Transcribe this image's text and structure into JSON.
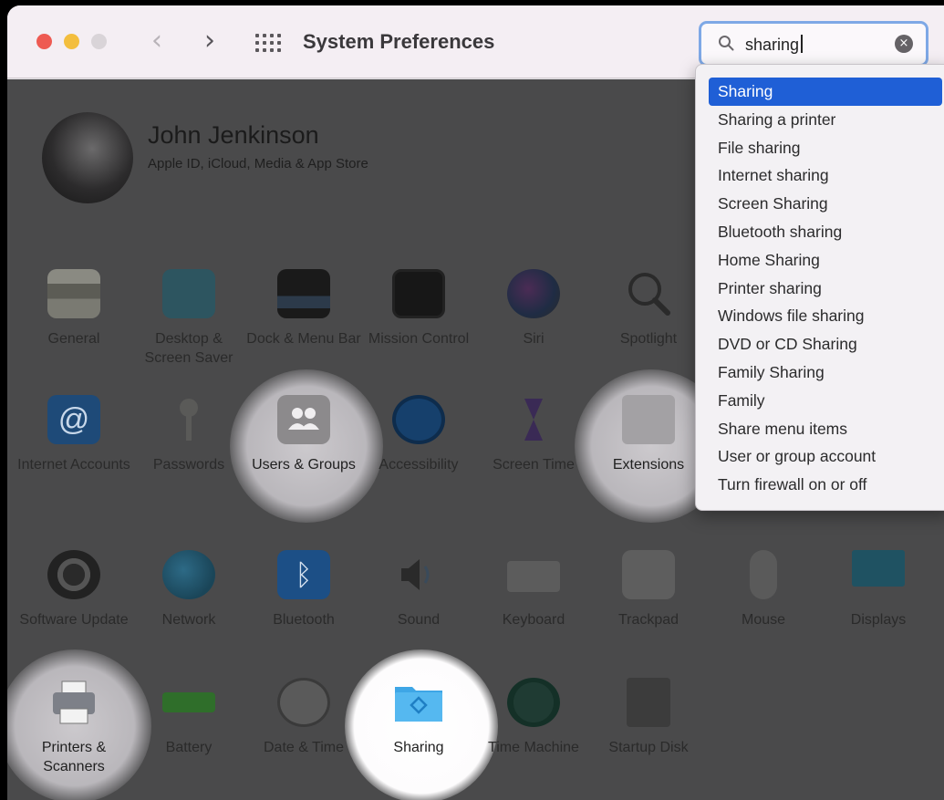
{
  "window": {
    "title": "System Preferences",
    "back_glyph": "‹",
    "forward_glyph": "›"
  },
  "search": {
    "value": "sharing",
    "clear_glyph": "×"
  },
  "account": {
    "name": "John Jenkinson",
    "subtitle": "Apple ID, iCloud, Media & App Store"
  },
  "panes": {
    "row1": [
      {
        "label": "General",
        "icon": "general-icon"
      },
      {
        "label": "Desktop & Screen Saver",
        "icon": "desktop-icon"
      },
      {
        "label": "Dock & Menu Bar",
        "icon": "dock-icon"
      },
      {
        "label": "Mission Control",
        "icon": "mission-control-icon"
      },
      {
        "label": "Siri",
        "icon": "siri-icon"
      },
      {
        "label": "Spotlight",
        "icon": "spotlight-icon"
      }
    ],
    "row2": [
      {
        "label": "Internet Accounts",
        "icon": "at-icon"
      },
      {
        "label": "Passwords",
        "icon": "key-icon"
      },
      {
        "label": "Users & Groups",
        "icon": "users-icon"
      },
      {
        "label": "Accessibility",
        "icon": "accessibility-icon"
      },
      {
        "label": "Screen Time",
        "icon": "hourglass-icon"
      },
      {
        "label": "Extensions",
        "icon": "puzzle-icon"
      }
    ],
    "row3": [
      {
        "label": "Software Update",
        "icon": "gear-icon"
      },
      {
        "label": "Network",
        "icon": "globe-icon"
      },
      {
        "label": "Bluetooth",
        "icon": "bluetooth-icon"
      },
      {
        "label": "Sound",
        "icon": "speaker-icon"
      },
      {
        "label": "Keyboard",
        "icon": "keyboard-icon"
      },
      {
        "label": "Trackpad",
        "icon": "trackpad-icon"
      },
      {
        "label": "Mouse",
        "icon": "mouse-icon"
      },
      {
        "label": "Displays",
        "icon": "display-icon"
      }
    ],
    "row4": [
      {
        "label": "Printers & Scanners",
        "icon": "printer-icon"
      },
      {
        "label": "Battery",
        "icon": "battery-icon"
      },
      {
        "label": "Date & Time",
        "icon": "clock-icon"
      },
      {
        "label": "Sharing",
        "icon": "folder-icon"
      },
      {
        "label": "Time Machine",
        "icon": "time-machine-icon"
      },
      {
        "label": "Startup Disk",
        "icon": "disk-icon"
      }
    ]
  },
  "suggestions": [
    "Sharing",
    "Sharing a printer",
    "File sharing",
    "Internet sharing",
    "Screen Sharing",
    "Bluetooth sharing",
    "Home Sharing",
    "Printer sharing",
    "Windows file sharing",
    "DVD or CD Sharing",
    "Family Sharing",
    "Family",
    "Share menu items",
    "User or group account",
    "Turn firewall on or off"
  ],
  "colors": {
    "selection": "#1f5fd6",
    "search_focus": "#7ea8e6",
    "dim_overlay": "#4a4a4b"
  }
}
